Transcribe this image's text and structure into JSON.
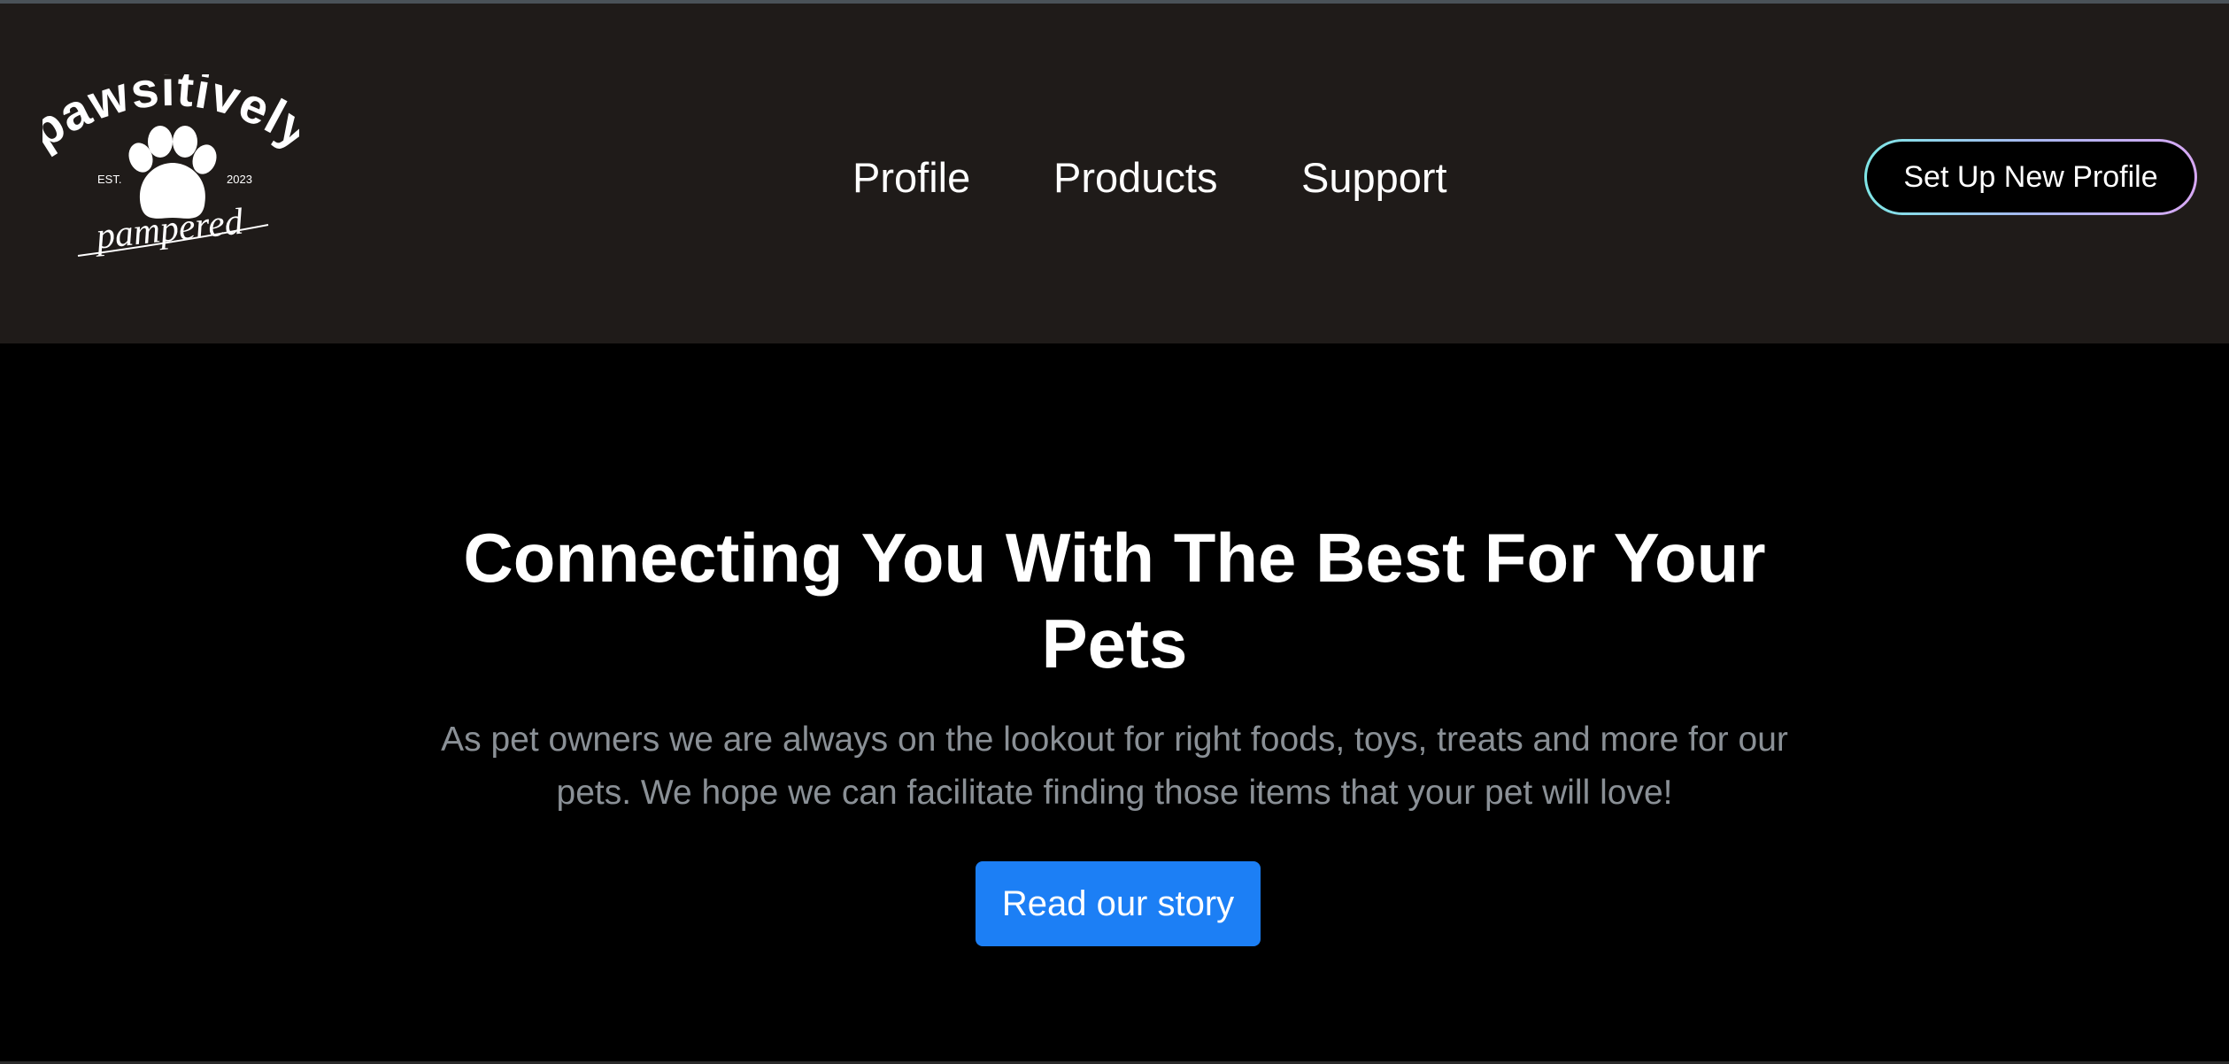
{
  "brand": {
    "logo_top": "pawsitively",
    "logo_bottom": "pampered",
    "logo_est": "EST.",
    "logo_year": "2023",
    "logo_icon": "paw-icon"
  },
  "nav": {
    "links": [
      {
        "label": "Profile"
      },
      {
        "label": "Products"
      },
      {
        "label": "Support"
      }
    ],
    "cta_label": "Set Up New Profile"
  },
  "hero": {
    "title_line1": "Connecting You With The Best For Your",
    "title_line2": "Pets",
    "desc_line1": "As pet owners we are always on the lookout for right foods, toys, treats and more for our",
    "desc_line2": "pets. We hope we can facilitate finding those items that your pet will love!",
    "button_label": "Read our story"
  },
  "colors": {
    "navbar_bg": "#1f1b19",
    "page_bg": "#000000",
    "primary_button": "#1c7ff5",
    "muted_text": "#8a9096",
    "cta_gradient_start": "#7fe6e6",
    "cta_gradient_end": "#d7a8f4"
  }
}
